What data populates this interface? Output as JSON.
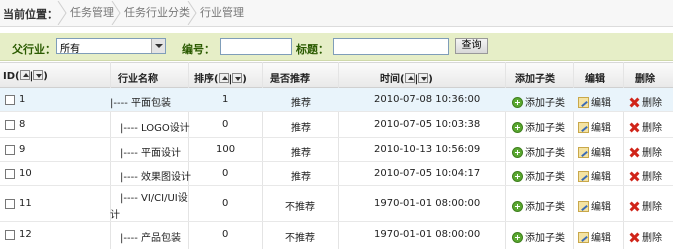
{
  "breadcrumb": {
    "label": "当前位置：",
    "items": [
      "任务管理",
      "任务行业分类",
      "行业管理"
    ]
  },
  "filter": {
    "parent_label": "父行业：",
    "parent_value": "所有",
    "number_label": "编号：",
    "title_label": "标题：",
    "search_button": "查询"
  },
  "table": {
    "headers": {
      "id": "ID",
      "name": "行业名称",
      "order": "排序",
      "recommend": "是否推荐",
      "time": "时间",
      "add": "添加子类",
      "edit": "编辑",
      "delete": "删除"
    },
    "rows": [
      {
        "id": "1",
        "name": "|---- 平面包装",
        "order": "1",
        "recommend": "推荐",
        "time": "2010-07-08 10:36:00",
        "add": "添加子类",
        "edit": "编辑",
        "delete": "删除"
      },
      {
        "id": "8",
        "name": "|---- LOGO设计",
        "order": "0",
        "recommend": "推荐",
        "time": "2010-07-05 10:03:38",
        "add": "添加子类",
        "edit": "编辑",
        "delete": "删除"
      },
      {
        "id": "9",
        "name": "|---- 平面设计",
        "order": "100",
        "recommend": "推荐",
        "time": "2010-10-13 10:56:09",
        "add": "添加子类",
        "edit": "编辑",
        "delete": "删除"
      },
      {
        "id": "10",
        "name": "|---- 效果图设计",
        "order": "0",
        "recommend": "推荐",
        "time": "2010-07-05 10:04:17",
        "add": "添加子类",
        "edit": "编辑",
        "delete": "删除"
      },
      {
        "id": "11",
        "name": "|---- VI/CI/UI设",
        "name2": "计",
        "order": "0",
        "recommend": "不推荐",
        "time": "1970-01-01 08:00:00",
        "add": "添加子类",
        "edit": "编辑",
        "delete": "删除"
      },
      {
        "id": "12",
        "name": "|---- 产品包装",
        "order": "0",
        "recommend": "不推荐",
        "time": "1970-01-01 08:00:00",
        "add": "添加子类",
        "edit": "编辑",
        "delete": "删除"
      }
    ]
  }
}
